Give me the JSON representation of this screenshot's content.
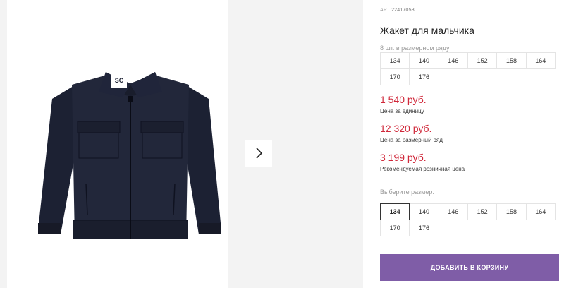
{
  "gallery": {
    "next_icon": "chevron-right-icon",
    "logo_text": "SC"
  },
  "product": {
    "art_label": "АРТ",
    "art_number": "22417053",
    "title": "Жакет для мальчика",
    "pack_note": "8 шт. в размерном ряду",
    "pack_sizes": [
      "134",
      "140",
      "146",
      "152",
      "158",
      "164",
      "170",
      "176"
    ]
  },
  "prices": {
    "unit_price": "1 540 руб.",
    "unit_note": "Цена за единицу",
    "pack_price": "12 320 руб.",
    "pack_note": "Цена за размерный ряд",
    "retail_price": "3 199 руб.",
    "retail_note": "Рекомендуемая розничная цена",
    "price_color": "#d0283a"
  },
  "size_select": {
    "label": "Выберите размер:",
    "sizes": [
      "134",
      "140",
      "146",
      "152",
      "158",
      "164",
      "170",
      "176"
    ],
    "selected": "134"
  },
  "cart": {
    "button_label": "Добавить в корзину",
    "button_color": "#7f5da7"
  }
}
